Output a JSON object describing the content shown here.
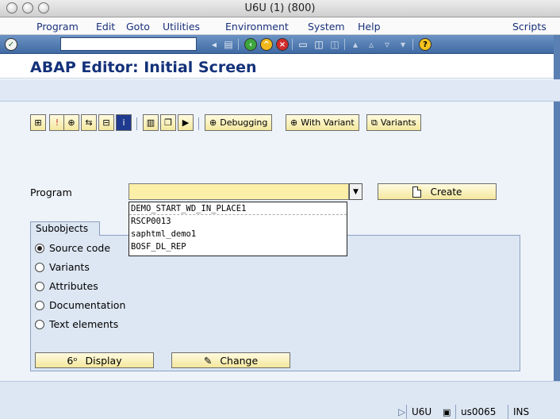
{
  "window": {
    "title": "U6U (1) (800)"
  },
  "menu": {
    "items": [
      "Program",
      "Edit",
      "Goto",
      "Utilities",
      "Environment",
      "System",
      "Help"
    ],
    "right_item": "Scripts"
  },
  "page": {
    "title": "ABAP Editor: Initial Screen"
  },
  "app_toolbar": {
    "debugging_label": "Debugging",
    "with_variant_label": "With Variant",
    "variants_label": "Variants"
  },
  "program": {
    "label": "Program",
    "value": "",
    "create_label": "Create",
    "history": [
      "DEMO_START_WD_IN_PLACE1",
      "RSCP0013",
      "saphtml_demo1",
      "BOSF_DL_REP"
    ]
  },
  "subobjects": {
    "tab_label": "Subobjects",
    "options": [
      {
        "label": "Source code",
        "selected": true
      },
      {
        "label": "Variants",
        "selected": false
      },
      {
        "label": "Attributes",
        "selected": false
      },
      {
        "label": "Documentation",
        "selected": false
      },
      {
        "label": "Text elements",
        "selected": false
      }
    ],
    "display_label": "Display",
    "change_label": "Change"
  },
  "status": {
    "system": "U6U",
    "server": "us0065",
    "mode": "INS"
  },
  "colors": {
    "title_blue": "#14327a",
    "system_bar": "#3f6aa3",
    "input_yellow": "#fcefa8",
    "button_yellow": "#f4e79d",
    "content_bg": "#eef3fa"
  }
}
